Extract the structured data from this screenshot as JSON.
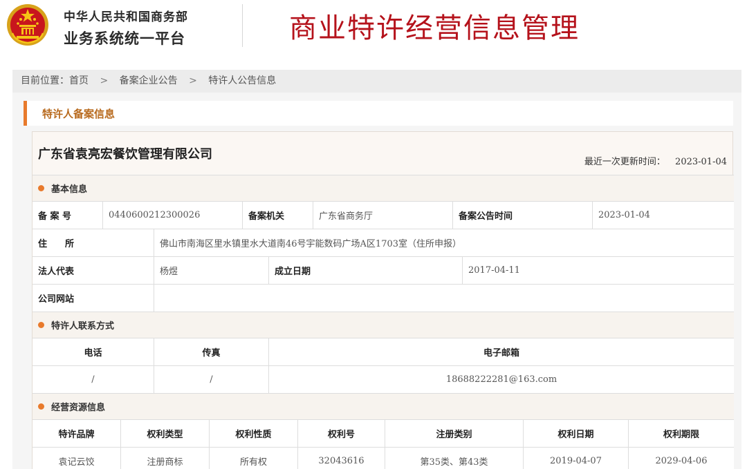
{
  "header": {
    "org_line1": "中华人民共和国商务部",
    "org_line2": "业务系统统一平台",
    "banner_title": "商业特许经营信息管理",
    "accent_color": "#b5121b"
  },
  "breadcrumb": {
    "prefix": "目前位置：首页",
    "items": [
      "备案企业公告",
      "特许人公告信息"
    ],
    "separator": ">"
  },
  "section": {
    "title": "特许人备案信息"
  },
  "company": {
    "name": "广东省袁亮宏餐饮管理有限公司",
    "last_update_label": "最近一次更新时间：",
    "last_update_value": "2023-01-04"
  },
  "basic_info": {
    "title": "基本信息",
    "record_no_label": "备 案 号",
    "record_no": "0440600212300026",
    "authority_label": "备案机关",
    "authority": "广东省商务厅",
    "announce_time_label": "备案公告时间",
    "announce_time": "2023-01-04",
    "address_label": "住　　所",
    "address": "佛山市南海区里水镇里水大道南46号宇能数码广场A区1703室（住所申报）",
    "legal_rep_label": "法人代表",
    "legal_rep": "杨煜",
    "founded_label": "成立日期",
    "founded": "2017-04-11",
    "website_label": "公司网站",
    "website": ""
  },
  "contact": {
    "title": "特许人联系方式",
    "headers": [
      "电话",
      "传真",
      "电子邮箱"
    ],
    "values": [
      "/",
      "/",
      "18688222281@163.com"
    ]
  },
  "resources": {
    "title": "经营资源信息",
    "headers": [
      "特许品牌",
      "权利类型",
      "权利性质",
      "权利号",
      "注册类别",
      "权利日期",
      "权利期限"
    ],
    "rows": [
      [
        "袁记云饺",
        "注册商标",
        "所有权",
        "32043616",
        "第35类、第43类",
        "2019-04-07",
        "2029-04-06"
      ]
    ]
  }
}
